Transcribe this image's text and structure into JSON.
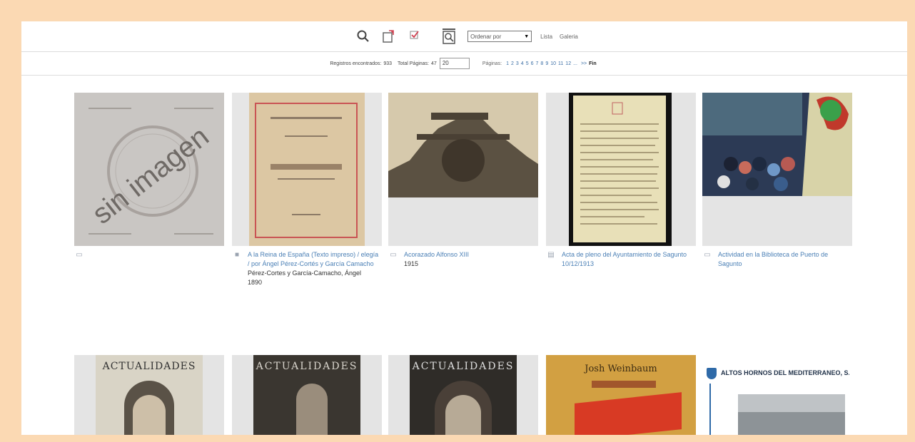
{
  "toolbar": {
    "order_select": "Ordenar por",
    "list_label": "Lista",
    "gallery_label": "Galeria"
  },
  "pagination": {
    "records_label": "Registros encontrados:",
    "records_count": "933",
    "total_pages_label": "Total Páginas:",
    "total_pages": "47",
    "per_page": "20",
    "pages_label": "Páginas:",
    "pages": [
      "1",
      "2",
      "3",
      "4",
      "5",
      "6",
      "7",
      "8",
      "9",
      "10",
      "11",
      "12",
      "..."
    ],
    "next_label": ">>",
    "end_label": "Fin"
  },
  "items": [
    {
      "title": "",
      "author": "",
      "date": "",
      "placeholder_text": "sin imagen",
      "type_icon": "image-icon"
    },
    {
      "title": "A la Reina de España (Texto impreso) / elegía / por Ángel Pérez-Cortés y García Camacho",
      "author": "Pérez-Cortes y García-Camacho, Ángel",
      "date": "1890",
      "type_icon": "book-icon"
    },
    {
      "title": "Acorazado Alfonso XIII",
      "author": "",
      "date": "1915",
      "type_icon": "photo-icon"
    },
    {
      "title": "Acta de pleno del Ayuntamiento de Sagunto",
      "author": "",
      "date": "10/12/1913",
      "type_icon": "document-icon"
    },
    {
      "title": "Actividad en la Biblioteca de Puerto de Sagunto",
      "author": "",
      "date": "",
      "type_icon": "photo-icon"
    }
  ],
  "row2": [
    {
      "cover_text": "ACTUALIDADES"
    },
    {
      "cover_text": "ACTUALIDADES"
    },
    {
      "cover_text": "ACTUALIDADES"
    },
    {
      "cover_text": "Josh Weinbaum"
    },
    {
      "cover_text": "ALTOS HORNOS DEL MEDITERRANEO, S. A."
    }
  ]
}
